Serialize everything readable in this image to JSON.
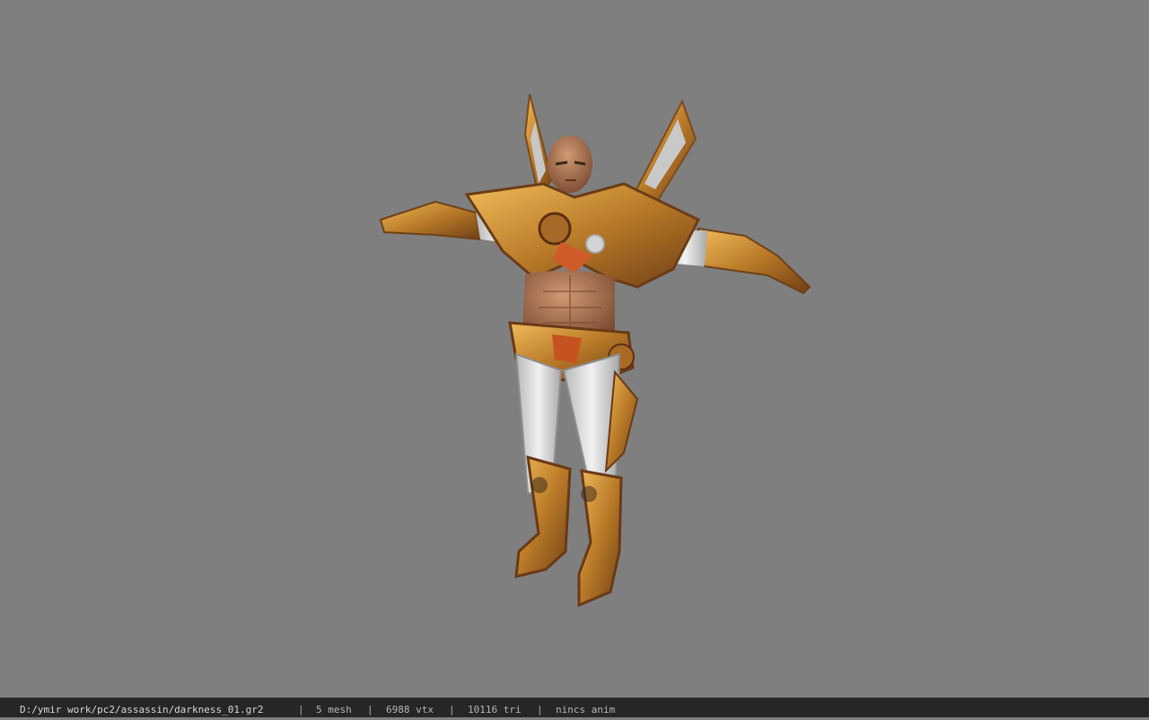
{
  "viewport": {
    "background_color": "#7f7f7f",
    "model": {
      "description_icon": "armored-character-model",
      "armor_color": "#c8902f",
      "cloth_color": "#d9d9d9",
      "skin_color": "#b87955"
    }
  },
  "status_bar": {
    "file_path": "D:/ymir work/pc2/assassin/darkness_01.gr2",
    "separators": [
      "|",
      "|",
      "|",
      "|"
    ],
    "mesh_count": "5 mesh",
    "vertex_count": "6988 vtx",
    "triangle_count": "10116 tri",
    "animation": "nincs anim"
  }
}
